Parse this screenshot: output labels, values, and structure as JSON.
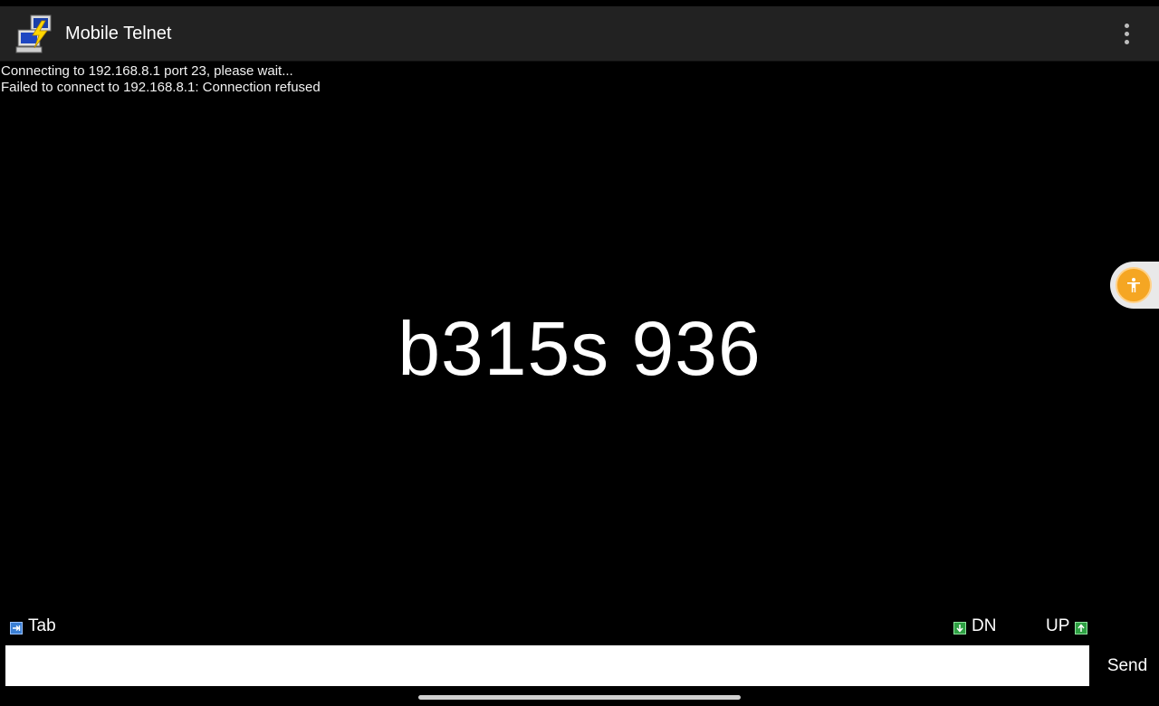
{
  "app_bar": {
    "title": "Mobile Telnet",
    "app_icon": "telnet-computers-lightning-icon",
    "menu_icon": "more-vert-icon"
  },
  "terminal": {
    "lines": [
      "Connecting to 192.168.8.1 port 23, please wait...",
      "Failed to connect to 192.168.8.1: Connection refused"
    ]
  },
  "overlay": {
    "text": "b315s 936"
  },
  "accessibility": {
    "icon": "accessibility-person-icon",
    "color": "#f5a623"
  },
  "keys": {
    "tab_label": "Tab",
    "dn_label": "DN",
    "up_label": "UP",
    "tab_icon": "tab-arrow-icon",
    "dn_icon": "arrow-down-green-icon",
    "up_icon": "arrow-up-green-icon"
  },
  "input": {
    "value": "",
    "placeholder": ""
  },
  "send": {
    "label": "Send"
  },
  "colors": {
    "app_bar_bg": "#222222",
    "terminal_bg": "#000000",
    "key_icon_green": "#2ea043",
    "tab_icon_blue": "#3b7fd4"
  }
}
